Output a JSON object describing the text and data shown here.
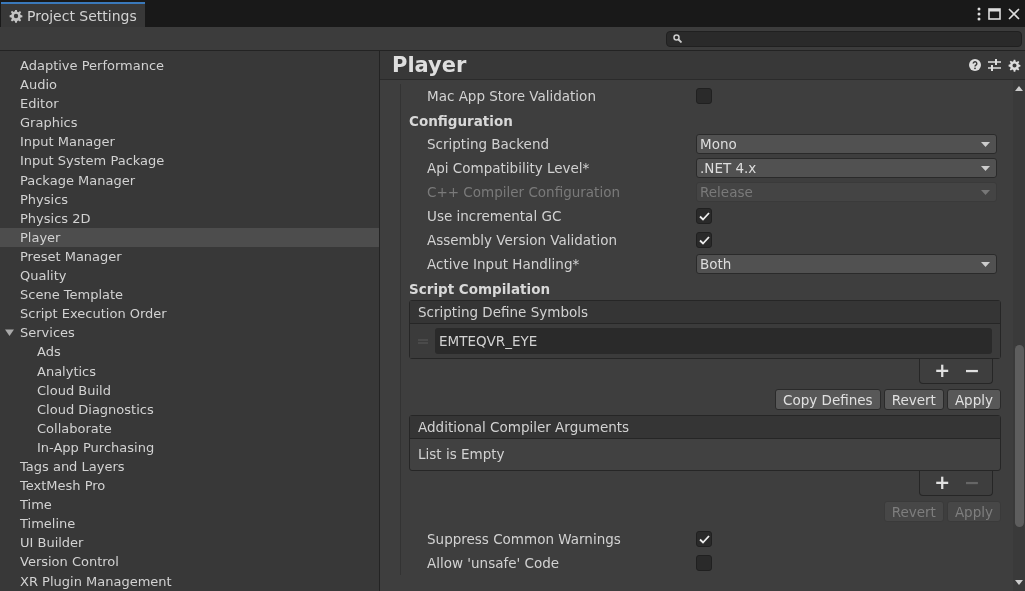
{
  "window": {
    "title": "Project Settings"
  },
  "sidebar": {
    "items": [
      {
        "label": "Adaptive Performance",
        "selected": false
      },
      {
        "label": "Audio",
        "selected": false
      },
      {
        "label": "Editor",
        "selected": false
      },
      {
        "label": "Graphics",
        "selected": false
      },
      {
        "label": "Input Manager",
        "selected": false
      },
      {
        "label": "Input System Package",
        "selected": false
      },
      {
        "label": "Package Manager",
        "selected": false
      },
      {
        "label": "Physics",
        "selected": false
      },
      {
        "label": "Physics 2D",
        "selected": false
      },
      {
        "label": "Player",
        "selected": true
      },
      {
        "label": "Preset Manager",
        "selected": false
      },
      {
        "label": "Quality",
        "selected": false
      },
      {
        "label": "Scene Template",
        "selected": false
      },
      {
        "label": "Script Execution Order",
        "selected": false
      },
      {
        "label": "Services",
        "selected": false,
        "expanded": true,
        "children": [
          {
            "label": "Ads",
            "selected": false
          },
          {
            "label": "Analytics",
            "selected": false
          },
          {
            "label": "Cloud Build",
            "selected": false
          },
          {
            "label": "Cloud Diagnostics",
            "selected": false
          },
          {
            "label": "Collaborate",
            "selected": false
          },
          {
            "label": "In-App Purchasing",
            "selected": false
          }
        ]
      },
      {
        "label": "Tags and Layers",
        "selected": false
      },
      {
        "label": "TextMesh Pro",
        "selected": false
      },
      {
        "label": "Time",
        "selected": false
      },
      {
        "label": "Timeline",
        "selected": false
      },
      {
        "label": "UI Builder",
        "selected": false
      },
      {
        "label": "Version Control",
        "selected": false
      },
      {
        "label": "XR Plugin Management",
        "selected": false
      }
    ]
  },
  "panel": {
    "title": "Player",
    "rows": [
      {
        "kind": "checkbox",
        "label": "Mac App Store Validation",
        "checked": false
      },
      {
        "kind": "heading",
        "label": "Configuration"
      },
      {
        "kind": "dropdown",
        "label": "Scripting Backend",
        "value": "Mono",
        "disabled": false
      },
      {
        "kind": "dropdown",
        "label": "Api Compatibility Level*",
        "value": ".NET 4.x",
        "disabled": false
      },
      {
        "kind": "dropdown",
        "label": "C++ Compiler Configuration",
        "value": "Release",
        "disabled": true
      },
      {
        "kind": "checkbox",
        "label": "Use incremental GC",
        "checked": true
      },
      {
        "kind": "checkbox",
        "label": "Assembly Version Validation",
        "checked": true
      },
      {
        "kind": "dropdown",
        "label": "Active Input Handling*",
        "value": "Both",
        "disabled": false
      },
      {
        "kind": "heading",
        "label": "Script Compilation"
      },
      {
        "kind": "list",
        "title": "Scripting Define Symbols",
        "items": [
          "EMTEQVR_EYE"
        ],
        "add": {
          "label": "+",
          "disabled": false
        },
        "remove": {
          "label": "−",
          "disabled": false
        }
      },
      {
        "kind": "buttons",
        "buttons": [
          {
            "label": "Copy Defines",
            "disabled": false
          },
          {
            "label": "Revert",
            "disabled": false
          },
          {
            "label": "Apply",
            "disabled": false
          }
        ]
      },
      {
        "kind": "list",
        "title": "Additional Compiler Arguments",
        "empty_text": "List is Empty",
        "add": {
          "label": "+",
          "disabled": false
        },
        "remove": {
          "label": "−",
          "disabled": true
        }
      },
      {
        "kind": "buttons",
        "buttons": [
          {
            "label": "Revert",
            "disabled": true
          },
          {
            "label": "Apply",
            "disabled": true
          }
        ]
      },
      {
        "kind": "checkbox",
        "label": "Suppress Common Warnings",
        "checked": true
      },
      {
        "kind": "checkbox",
        "label": "Allow 'unsafe' Code",
        "checked": false
      }
    ]
  }
}
